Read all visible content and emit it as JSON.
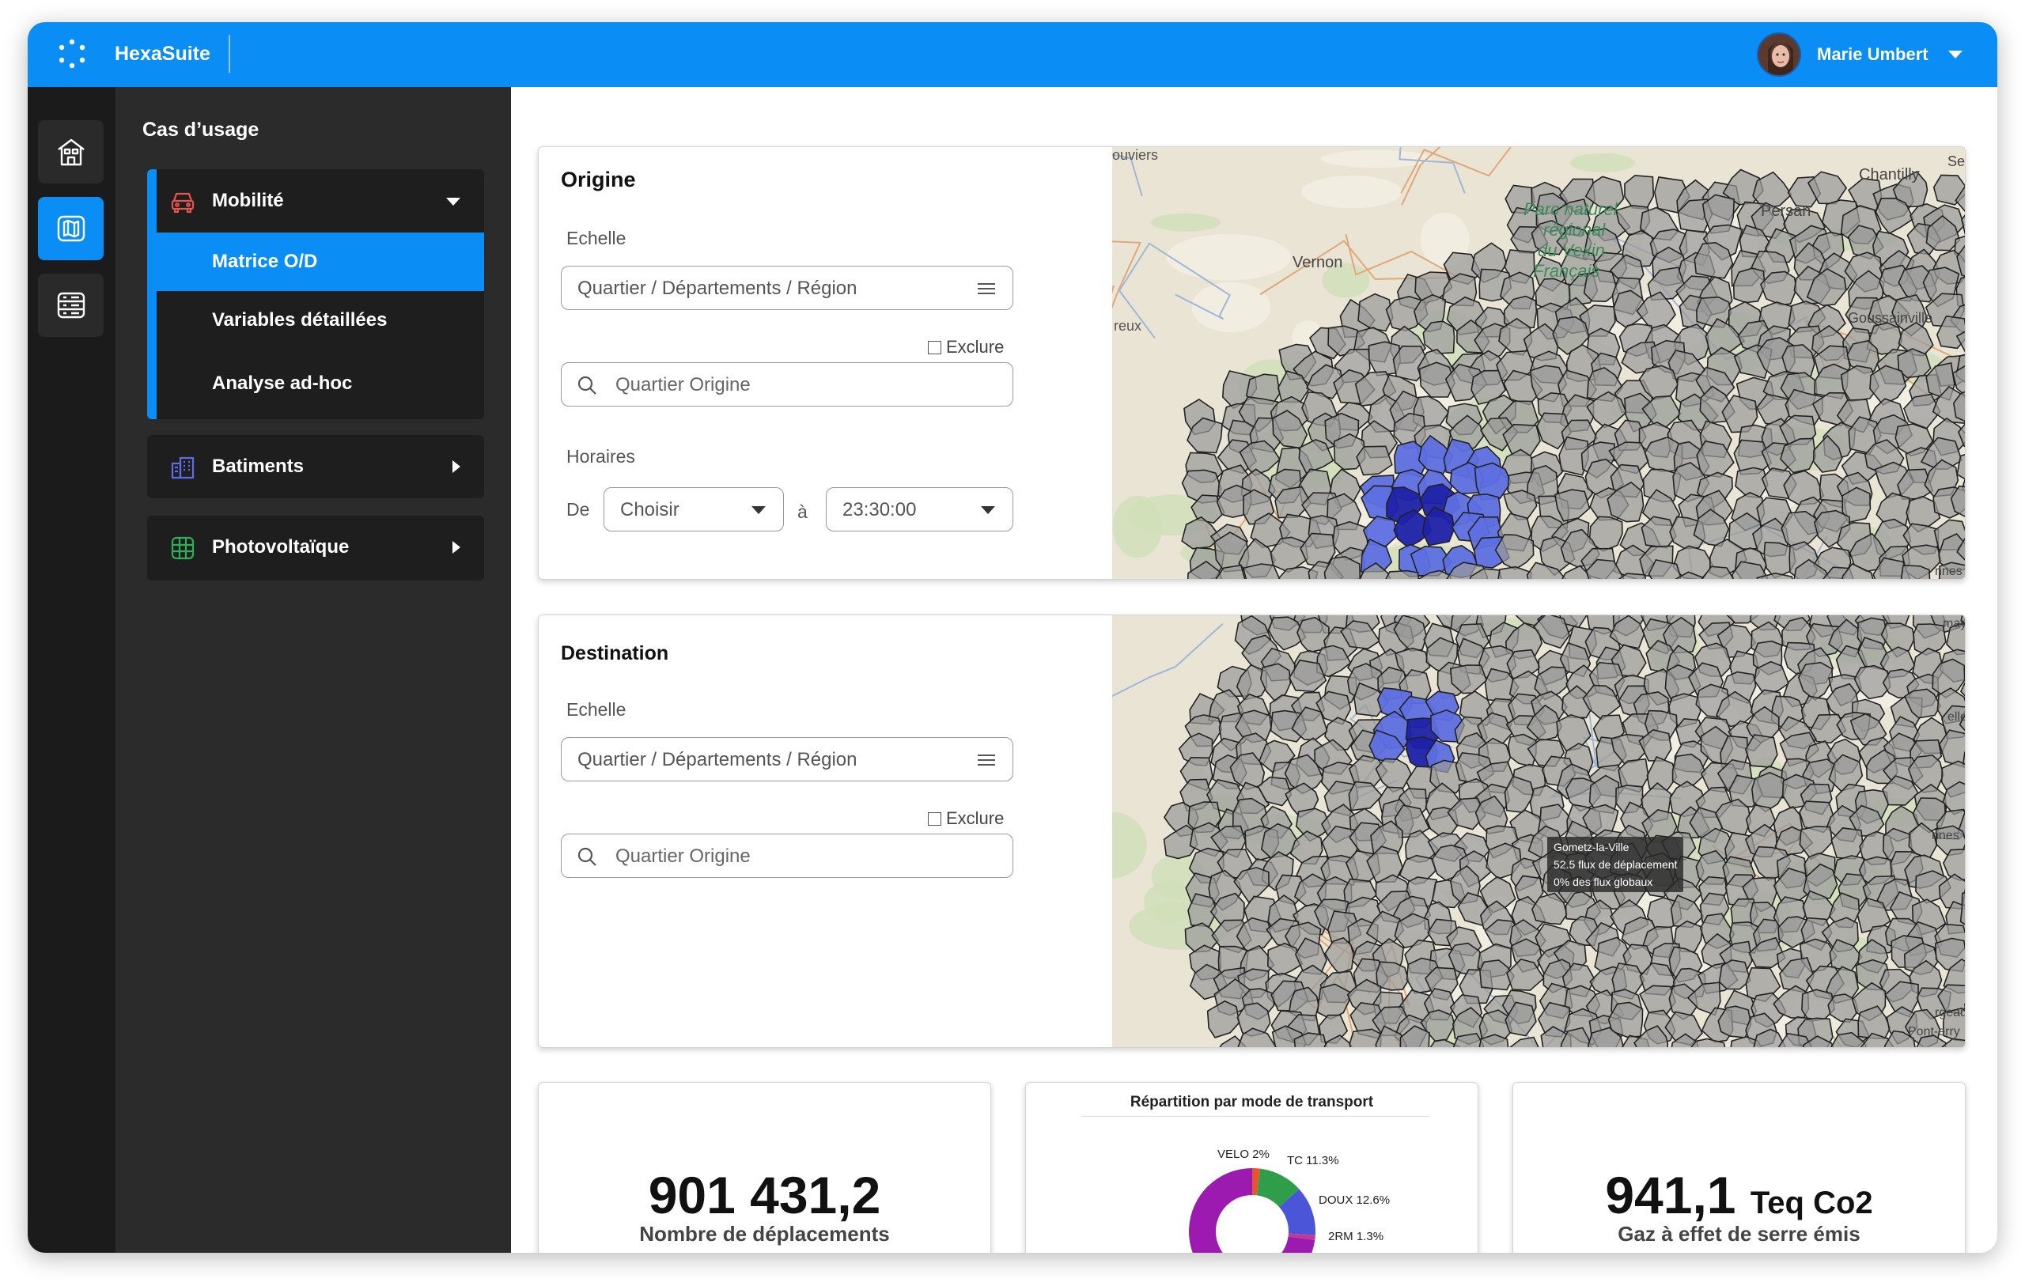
{
  "app": {
    "name": "HexaSuite"
  },
  "user": {
    "name": "Marie Umbert"
  },
  "sidebar": {
    "title": "Cas d’usage",
    "groups": [
      {
        "label": "Mobilité",
        "items": [
          "Matrice O/D",
          "Variables détaillées",
          "Analyse ad-hoc"
        ]
      },
      {
        "label": "Batiments"
      },
      {
        "label": "Photovoltaïque"
      }
    ]
  },
  "origine": {
    "title": "Origine",
    "scale_label": "Echelle",
    "scale_value": "Quartier / Départements / Région",
    "exclude_label": "Exclure",
    "search_placeholder": "Quartier Origine",
    "hours_label": "Horaires",
    "from_label": "De",
    "from_value": "Choisir",
    "to_label": "à",
    "to_value": "23:30:00"
  },
  "destination": {
    "title": "Destination",
    "scale_label": "Echelle",
    "scale_value": "Quartier / Départements / Région",
    "exclude_label": "Exclure",
    "search_placeholder": "Quartier Origine"
  },
  "map_labels": {
    "origine": [
      "ouviers",
      "Parc naturel",
      "régional",
      "du Vexin",
      "Français",
      "Vernon",
      "reux",
      "Chantilly",
      "Persan",
      "Goussainville",
      "Ser",
      "nnes"
    ],
    "destination": [
      "nnes",
      "rgeau",
      "Pont-erry",
      "elle",
      "may"
    ]
  },
  "tooltip": {
    "line1": "Gometz-la-Ville",
    "line2": "52.5 flux de déplacement",
    "line3": "0% des flux globaux"
  },
  "kpis": {
    "trips_value": "901 431,2",
    "trips_label": "Nombre de déplacements",
    "ghg_value": "941,1",
    "ghg_unit": "Teq Co2",
    "ghg_label": "Gaz à effet de serre émis"
  },
  "chart_data": {
    "type": "pie",
    "title": "Répartition par mode de transport",
    "categories": [
      "VELO",
      "TC",
      "DOUX",
      "2RM"
    ],
    "values": [
      2,
      11.3,
      12.6,
      1.3
    ],
    "labels": [
      "VELO 2%",
      "TC 11.3%",
      "DOUX 12.6%",
      "2RM 1.3%"
    ],
    "colors": {
      "VELO": "#e8542c",
      "TC": "#2e9e4a",
      "DOUX": "#4a55d8",
      "2RM": "#c0389a",
      "other": "#9c1ab0"
    }
  }
}
